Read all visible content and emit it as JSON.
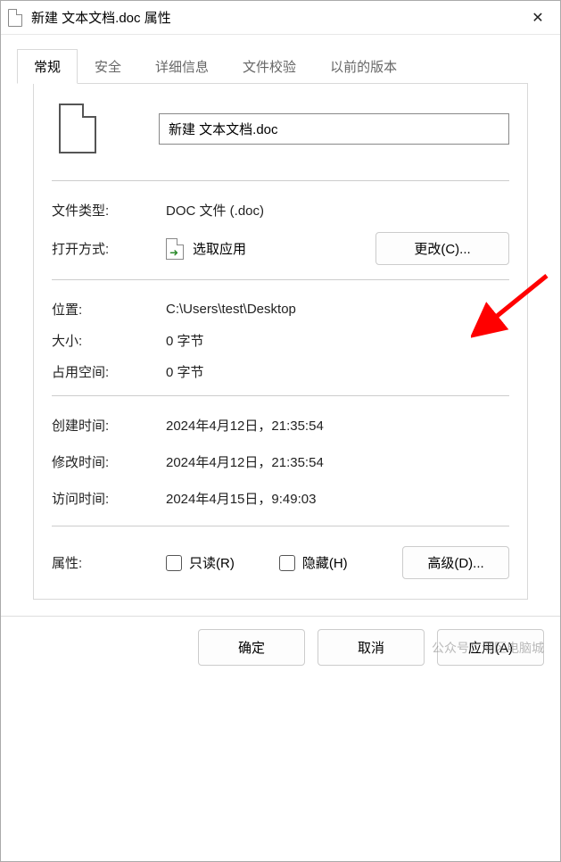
{
  "titlebar": {
    "title": "新建 文本文档.doc 属性"
  },
  "tabs": {
    "general": "常规",
    "security": "安全",
    "details": "详细信息",
    "fileverify": "文件校验",
    "previous": "以前的版本"
  },
  "filename": "新建 文本文档.doc",
  "labels": {
    "filetype": "文件类型:",
    "openwith": "打开方式:",
    "location": "位置:",
    "size": "大小:",
    "sizeondisk": "占用空间:",
    "created": "创建时间:",
    "modified": "修改时间:",
    "accessed": "访问时间:",
    "attributes": "属性:"
  },
  "values": {
    "filetype": "DOC 文件 (.doc)",
    "openwith": "选取应用",
    "location": "C:\\Users\\test\\Desktop",
    "size": "0 字节",
    "sizeondisk": "0 字节",
    "created": "2024年4月12日，21:35:54",
    "modified": "2024年4月12日，21:35:54",
    "accessed": "2024年4月15日，9:49:03"
  },
  "buttons": {
    "change": "更改(C)...",
    "advanced": "高级(D)...",
    "ok": "确定",
    "cancel": "取消",
    "apply": "应用(A)"
  },
  "checkboxes": {
    "readonly": "只读(R)",
    "hidden": "隐藏(H)"
  },
  "watermark": "公众号：湾区电脑城"
}
